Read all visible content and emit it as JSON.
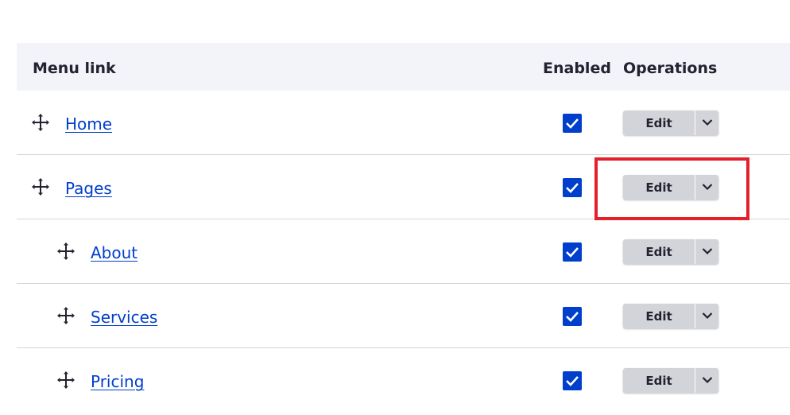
{
  "table": {
    "headers": {
      "menu_link": "Menu link",
      "enabled": "Enabled",
      "operations": "Operations"
    },
    "rows": [
      {
        "label": "Home",
        "enabled": true,
        "level": 0,
        "action": "Edit"
      },
      {
        "label": "Pages",
        "enabled": true,
        "level": 0,
        "action": "Edit"
      },
      {
        "label": "About",
        "enabled": true,
        "level": 1,
        "action": "Edit"
      },
      {
        "label": "Services",
        "enabled": true,
        "level": 1,
        "action": "Edit"
      },
      {
        "label": "Pricing",
        "enabled": true,
        "level": 1,
        "action": "Edit"
      }
    ]
  },
  "icons": {
    "drag": "move-arrows-icon",
    "checkbox": "checkmark-icon",
    "toggle": "chevron-down-icon"
  },
  "colors": {
    "link": "#003ecc",
    "checkbox": "#003ecc",
    "header_bg": "#f3f4f9",
    "button_bg": "#d3d4d9",
    "highlight": "#e3202c"
  }
}
